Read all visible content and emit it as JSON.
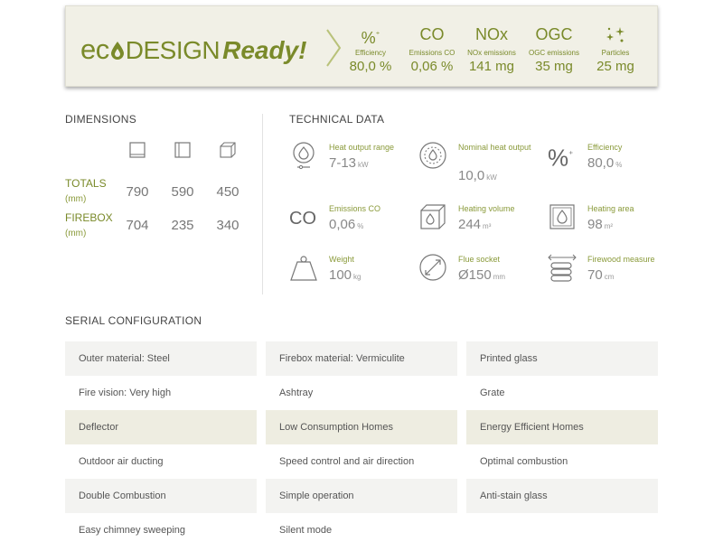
{
  "eco_banner": {
    "logo_eco": "ec",
    "logo_design": "DESIGN",
    "logo_ready": "Ready!",
    "metrics": [
      {
        "symbol": "%",
        "label": "Efficiency",
        "value": "80,0 %"
      },
      {
        "symbol": "CO",
        "label": "Emissions CO",
        "value": "0,06 %"
      },
      {
        "symbol": "NOx",
        "label": "NOx emissions",
        "value": "141 mg"
      },
      {
        "symbol": "OGC",
        "label": "OGC emissions",
        "value": "35 mg"
      },
      {
        "symbol": "",
        "label": "Particles",
        "value": "25 mg"
      }
    ],
    "accent_color": "#7a8a2a"
  },
  "dimensions": {
    "title": "DIMENSIONS",
    "rows": [
      {
        "label": "TOTALS",
        "unit": "(mm)",
        "values": [
          "790",
          "590",
          "450"
        ]
      },
      {
        "label": "FIREBOX",
        "unit": "(mm)",
        "values": [
          "704",
          "235",
          "340"
        ]
      }
    ]
  },
  "technical_data": {
    "title": "TECHNICAL DATA",
    "items": [
      {
        "label": "Heat output range",
        "value": "7-13",
        "unit": "kW",
        "icon": "heat-output-icon"
      },
      {
        "label": "Nominal heat output",
        "value": "10,0",
        "unit": "kW",
        "icon": "flame-gauge-icon"
      },
      {
        "label": "Efficiency",
        "value": "80,0",
        "unit": "%",
        "icon": "percent-icon"
      },
      {
        "label": "Emissions CO",
        "value": "0,06",
        "unit": "%",
        "icon": "co-icon"
      },
      {
        "label": "Heating volume",
        "value": "244",
        "unit": "m³",
        "icon": "cube-flame-icon"
      },
      {
        "label": "Heating area",
        "value": "98",
        "unit": "m²",
        "icon": "square-flame-icon"
      },
      {
        "label": "Weight",
        "value": "100",
        "unit": "kg",
        "icon": "weight-icon"
      },
      {
        "label": "Flue socket",
        "value": "Ø150",
        "unit": "mm",
        "icon": "diameter-icon"
      },
      {
        "label": "Firewood measure",
        "value": "70",
        "unit": "cm",
        "icon": "firewood-icon"
      }
    ]
  },
  "serial_configuration": {
    "title": "SERIAL CONFIGURATION",
    "rows": [
      [
        "Outer material: Steel",
        "Firebox material: Vermiculite",
        "Printed glass"
      ],
      [
        "Fire vision: Very high",
        "Ashtray",
        "Grate"
      ],
      [
        "Deflector",
        "Low Consumption Homes",
        "Energy Efficient Homes"
      ],
      [
        "Outdoor air ducting",
        "Speed control and air direction",
        "Optimal combustion"
      ],
      [
        "Double Combustion",
        "Simple operation",
        "Anti-stain glass"
      ],
      [
        "Easy chimney sweeping",
        "Silent mode",
        ""
      ]
    ]
  }
}
